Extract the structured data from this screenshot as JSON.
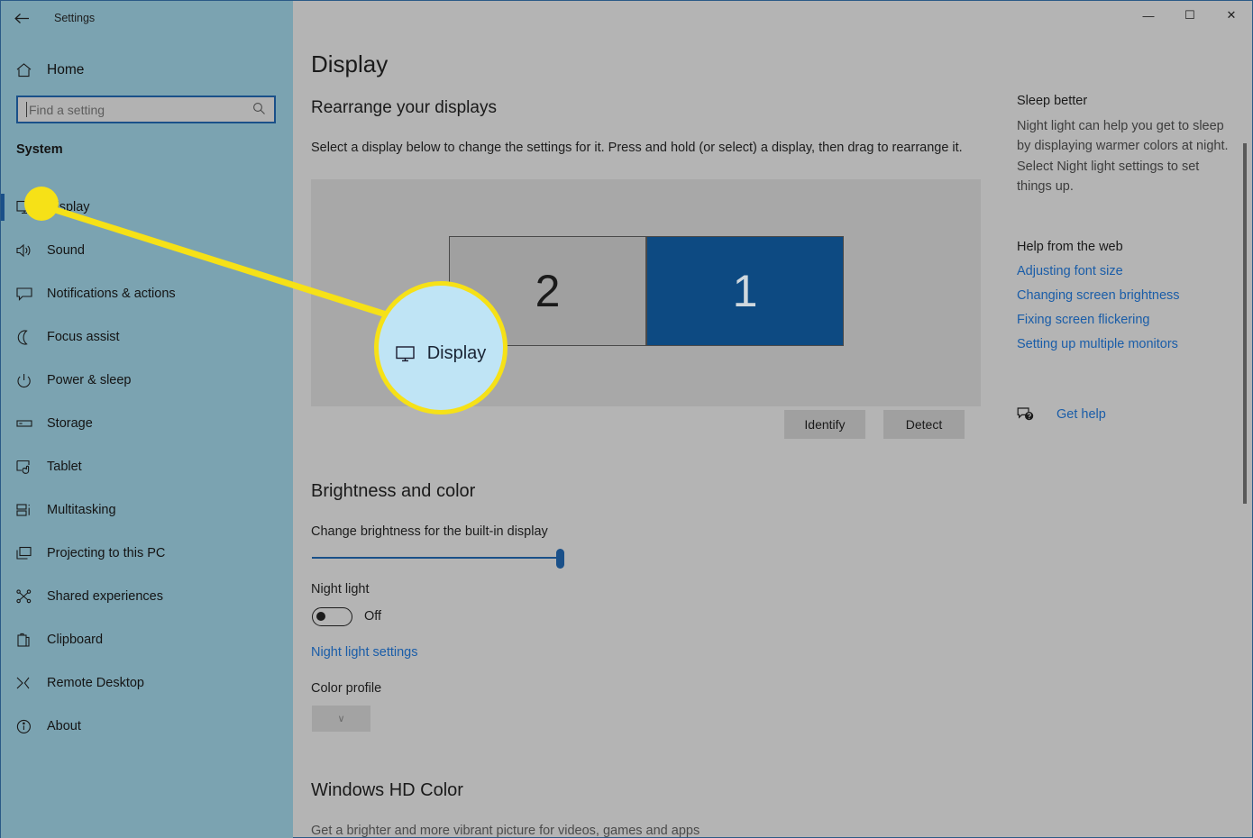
{
  "window": {
    "title": "Settings",
    "back_icon": "back-arrow-icon",
    "minimize_label": "—",
    "maximize_label": "☐",
    "close_label": "✕"
  },
  "sidebar": {
    "home_label": "Home",
    "home_icon": "home-icon",
    "search": {
      "placeholder": "Find a setting",
      "value": "",
      "icon": "search-icon"
    },
    "section_label": "System",
    "items": [
      {
        "label": "Display",
        "icon": "monitor-icon",
        "selected": true
      },
      {
        "label": "Sound",
        "icon": "speaker-icon",
        "selected": false
      },
      {
        "label": "Notifications & actions",
        "icon": "chat-bubble-icon",
        "selected": false
      },
      {
        "label": "Focus assist",
        "icon": "moon-icon",
        "selected": false
      },
      {
        "label": "Power & sleep",
        "icon": "power-icon",
        "selected": false
      },
      {
        "label": "Storage",
        "icon": "drive-icon",
        "selected": false
      },
      {
        "label": "Tablet",
        "icon": "tablet-icon",
        "selected": false
      },
      {
        "label": "Multitasking",
        "icon": "multitasking-icon",
        "selected": false
      },
      {
        "label": "Projecting to this PC",
        "icon": "projecting-icon",
        "selected": false
      },
      {
        "label": "Shared experiences",
        "icon": "share-icon",
        "selected": false
      },
      {
        "label": "Clipboard",
        "icon": "clipboard-icon",
        "selected": false
      },
      {
        "label": "Remote Desktop",
        "icon": "remote-desktop-icon",
        "selected": false
      },
      {
        "label": "About",
        "icon": "info-icon",
        "selected": false
      }
    ]
  },
  "main": {
    "page_title": "Display",
    "rearrange": {
      "heading": "Rearrange your displays",
      "description": "Select a display below to change the settings for it. Press and hold (or select) a display, then drag to rearrange it.",
      "monitors": [
        {
          "number": "2",
          "selected": false
        },
        {
          "number": "1",
          "selected": true
        }
      ],
      "identify_label": "Identify",
      "detect_label": "Detect"
    },
    "brightness": {
      "heading": "Brightness and color",
      "slider_label": "Change brightness for the built-in display",
      "slider_value": "100",
      "night_light_label": "Night light",
      "night_light_state": "Off",
      "night_light_link": "Night light settings",
      "color_profile_label": "Color profile",
      "color_profile_value": "",
      "color_profile_chevron": "∨"
    },
    "hd_color": {
      "heading": "Windows HD Color",
      "description": "Get a brighter and more vibrant picture for videos, games and apps"
    }
  },
  "rail": {
    "sleep": {
      "heading": "Sleep better",
      "body": "Night light can help you get to sleep by displaying warmer colors at night. Select Night light settings to set things up."
    },
    "help": {
      "heading": "Help from the web",
      "links": [
        "Adjusting font size",
        "Changing screen brightness",
        "Fixing screen flickering",
        "Setting up multiple monitors"
      ]
    },
    "get_help": {
      "label": "Get help",
      "icon": "help-bubble-icon"
    }
  },
  "annotation": {
    "callout_label": "Display",
    "callout_icon": "monitor-icon",
    "ring_color": "#f6e117",
    "fill_color": "#bfe4f5"
  },
  "colors": {
    "sidebar_bg": "#7ba3b1",
    "main_bg": "#b4b4b4",
    "accent": "#1a5089",
    "link": "#1a5da8",
    "monitor_selected": "#0d4a82",
    "monitor_unselected": "#a0a0a0"
  }
}
